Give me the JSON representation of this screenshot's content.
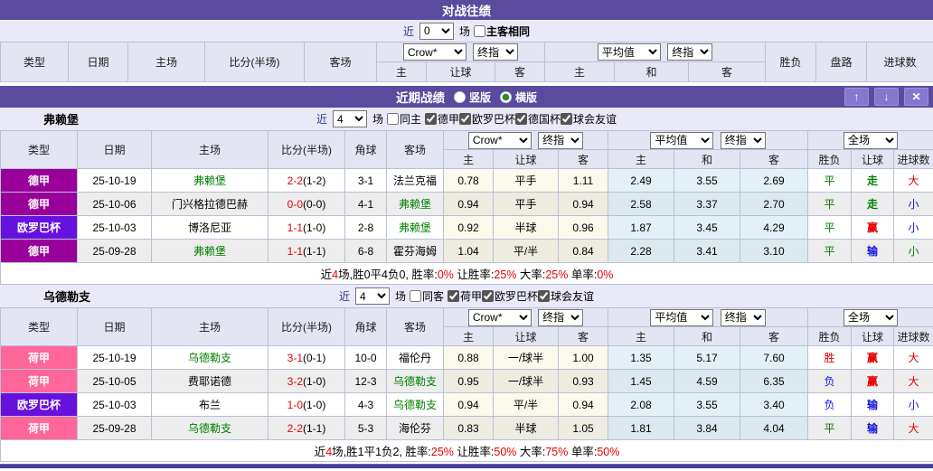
{
  "colors": {
    "bar": "#5b4b9e",
    "purple": "#990099",
    "violet": "#6611dd",
    "pink": "#ff6699",
    "green": "#008000",
    "red": "#e60000",
    "blue": "#1515dd"
  },
  "h2h": {
    "title": "对战往绩",
    "filter": {
      "near": "近",
      "rounds": "0",
      "unit": "场",
      "same": "主客相同"
    }
  },
  "cols": {
    "type": "类型",
    "date": "日期",
    "home": "主场",
    "score": "比分(半场)",
    "corner": "角球",
    "away": "客场",
    "crow": "Crow*",
    "final": "终指",
    "avg": "平均值",
    "full": "全场",
    "sub_home": "主",
    "sub_hcap": "让球",
    "sub_away": "客",
    "sub_h": "主",
    "sub_d": "和",
    "sub_a": "客",
    "result": "胜负",
    "path": "盘路",
    "hcap": "让球",
    "goals": "进球数"
  },
  "recent": {
    "title": "近期战绩",
    "vertical": "竖版",
    "horizontal": "横版"
  },
  "sections": [
    {
      "team": "弗赖堡",
      "near": "近",
      "rounds": "4",
      "unit": "场",
      "same": "同主",
      "leagues": [
        "德甲",
        "欧罗巴杯",
        "德国杯",
        "球会友谊"
      ],
      "rows": [
        {
          "league": "德甲",
          "badge": "purple",
          "date": "25-10-19",
          "home": "弗赖堡",
          "homeHl": true,
          "ft": "2-2",
          "ht": "(1-2)",
          "corner": "3-1",
          "away": "法兰克福",
          "awayHl": false,
          "crowHome": "0.78",
          "crowHcap": "平手",
          "crowAway": "1.11",
          "avgHome": "2.49",
          "avgDraw": "3.55",
          "avgAway": "2.69",
          "result": "平",
          "resultColor": "green",
          "hcapResult": "走",
          "hcapColor": "green",
          "goals": "大",
          "goalsColor": "red"
        },
        {
          "league": "德甲",
          "badge": "purple",
          "date": "25-10-06",
          "home": "门兴格拉德巴赫",
          "homeHl": false,
          "ft": "0-0",
          "ht": "(0-0)",
          "corner": "4-1",
          "away": "弗赖堡",
          "awayHl": true,
          "crowHome": "0.94",
          "crowHcap": "平手",
          "crowAway": "0.94",
          "avgHome": "2.58",
          "avgDraw": "3.37",
          "avgAway": "2.70",
          "result": "平",
          "resultColor": "green",
          "hcapResult": "走",
          "hcapColor": "green",
          "goals": "小",
          "goalsColor": "blue"
        },
        {
          "league": "欧罗巴杯",
          "badge": "violet",
          "date": "25-10-03",
          "home": "博洛尼亚",
          "homeHl": false,
          "ft": "1-1",
          "ht": "(1-0)",
          "corner": "2-8",
          "away": "弗赖堡",
          "awayHl": true,
          "crowHome": "0.92",
          "crowHcap": "半球",
          "crowAway": "0.96",
          "avgHome": "1.87",
          "avgDraw": "3.45",
          "avgAway": "4.29",
          "result": "平",
          "resultColor": "green",
          "hcapResult": "赢",
          "hcapColor": "red",
          "goals": "小",
          "goalsColor": "blue"
        },
        {
          "league": "德甲",
          "badge": "purple",
          "date": "25-09-28",
          "home": "弗赖堡",
          "homeHl": true,
          "ft": "1-1",
          "ht": "(1-1)",
          "corner": "6-8",
          "away": "霍芬海姆",
          "awayHl": false,
          "crowHome": "1.04",
          "crowHcap": "平/半",
          "crowAway": "0.84",
          "avgHome": "2.28",
          "avgDraw": "3.41",
          "avgAway": "3.10",
          "result": "平",
          "resultColor": "green",
          "hcapResult": "输",
          "hcapColor": "blue",
          "goals": "小",
          "goalsColor": "green"
        }
      ],
      "summary": [
        {
          "t": "近",
          "c": "k"
        },
        {
          "t": "4",
          "c": "r"
        },
        {
          "t": "场,胜0平4负0, 胜率:",
          "c": "k"
        },
        {
          "t": "0%",
          "c": "r"
        },
        {
          "t": " 让胜率:",
          "c": "k"
        },
        {
          "t": "25%",
          "c": "r"
        },
        {
          "t": " 大率:",
          "c": "k"
        },
        {
          "t": "25%",
          "c": "r"
        },
        {
          "t": " 单率:",
          "c": "k"
        },
        {
          "t": "0%",
          "c": "r"
        }
      ]
    },
    {
      "team": "乌德勒支",
      "near": "近",
      "rounds": "4",
      "unit": "场",
      "same": "同客",
      "leagues": [
        "荷甲",
        "欧罗巴杯",
        "球会友谊"
      ],
      "rows": [
        {
          "league": "荷甲",
          "badge": "pink",
          "date": "25-10-19",
          "home": "乌德勒支",
          "homeHl": true,
          "ft": "3-1",
          "ht": "(0-1)",
          "corner": "10-0",
          "away": "福伦丹",
          "awayHl": false,
          "crowHome": "0.88",
          "crowHcap": "一/球半",
          "crowAway": "1.00",
          "avgHome": "1.35",
          "avgDraw": "5.17",
          "avgAway": "7.60",
          "result": "胜",
          "resultColor": "red",
          "hcapResult": "赢",
          "hcapColor": "red",
          "goals": "大",
          "goalsColor": "red"
        },
        {
          "league": "荷甲",
          "badge": "pink",
          "date": "25-10-05",
          "home": "费耶诺德",
          "homeHl": false,
          "ft": "3-2",
          "ht": "(1-0)",
          "corner": "12-3",
          "away": "乌德勒支",
          "awayHl": true,
          "crowHome": "0.95",
          "crowHcap": "一/球半",
          "crowAway": "0.93",
          "avgHome": "1.45",
          "avgDraw": "4.59",
          "avgAway": "6.35",
          "result": "负",
          "resultColor": "blue",
          "hcapResult": "赢",
          "hcapColor": "red",
          "goals": "大",
          "goalsColor": "red"
        },
        {
          "league": "欧罗巴杯",
          "badge": "violet",
          "date": "25-10-03",
          "home": "布兰",
          "homeHl": false,
          "ft": "1-0",
          "ht": "(1-0)",
          "corner": "4-3",
          "away": "乌德勒支",
          "awayHl": true,
          "crowHome": "0.94",
          "crowHcap": "平/半",
          "crowAway": "0.94",
          "avgHome": "2.08",
          "avgDraw": "3.55",
          "avgAway": "3.40",
          "result": "负",
          "resultColor": "blue",
          "hcapResult": "输",
          "hcapColor": "blue",
          "goals": "小",
          "goalsColor": "blue"
        },
        {
          "league": "荷甲",
          "badge": "pink",
          "date": "25-09-28",
          "home": "乌德勒支",
          "homeHl": true,
          "ft": "2-2",
          "ht": "(1-1)",
          "corner": "5-3",
          "away": "海伦芬",
          "awayHl": false,
          "crowHome": "0.83",
          "crowHcap": "半球",
          "crowAway": "1.05",
          "avgHome": "1.81",
          "avgDraw": "3.84",
          "avgAway": "4.04",
          "result": "平",
          "resultColor": "green",
          "hcapResult": "输",
          "hcapColor": "blue",
          "goals": "大",
          "goalsColor": "red"
        }
      ],
      "summary": [
        {
          "t": "近",
          "c": "k"
        },
        {
          "t": "4",
          "c": "r"
        },
        {
          "t": "场,胜1平1负2, 胜率:",
          "c": "k"
        },
        {
          "t": "25%",
          "c": "r"
        },
        {
          "t": " 让胜率:",
          "c": "k"
        },
        {
          "t": "50%",
          "c": "r"
        },
        {
          "t": " 大率:",
          "c": "k"
        },
        {
          "t": "75%",
          "c": "r"
        },
        {
          "t": " 单率:",
          "c": "k"
        },
        {
          "t": "50%",
          "c": "r"
        }
      ]
    }
  ]
}
